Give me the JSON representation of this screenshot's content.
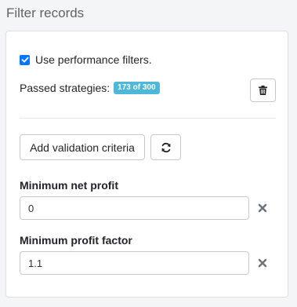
{
  "page": {
    "title": "Filter records"
  },
  "filters": {
    "use_performance_label": "Use performance filters.",
    "use_performance_checked": true,
    "passed_label": "Passed strategies:",
    "passed_badge": "173 of 300",
    "add_criteria_label": "Add validation criteria",
    "fields": [
      {
        "label": "Minimum net profit",
        "value": "0"
      },
      {
        "label": "Minimum profit factor",
        "value": "1.1"
      }
    ]
  },
  "icons": {
    "trash": "trash-icon",
    "refresh": "refresh-icon",
    "clear": "close-icon",
    "check": "check-icon"
  },
  "colors": {
    "accent": "#0075ff",
    "badge": "#4fb7d7"
  }
}
